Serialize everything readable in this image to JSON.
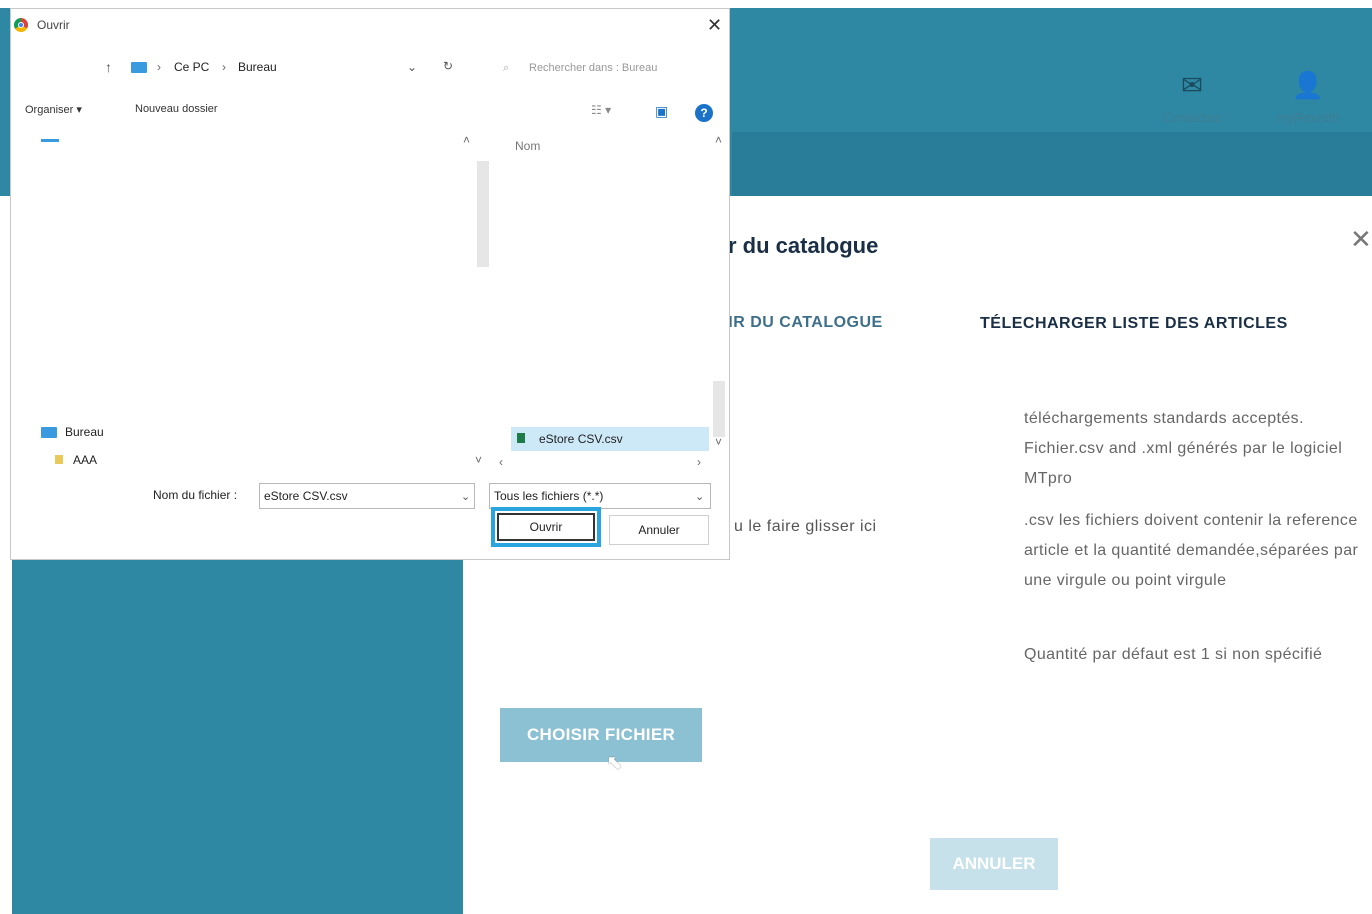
{
  "site": {
    "header": {
      "contact_label": "Contactez",
      "account_label": "myRexroth",
      "contact_icon": "envelope-icon",
      "account_icon": "user-icon"
    }
  },
  "modal": {
    "title_partial": "r du catalogue",
    "tabs": [
      {
        "label": "TIR DU CATALOGUE",
        "active": false
      },
      {
        "label": "TÉLECHARGER LISTE DES ARTICLES",
        "active": true
      }
    ],
    "drag_text": "u le faire glisser ici",
    "info": [
      "téléchargements standards acceptés. Fichier.csv and .xml générés par le logiciel MTpro",
      ".csv les fichiers doivent contenir la reference article et la quantité demandée,séparées par une virgule ou point virgule",
      "Quantité par défaut est 1 si non spécifié"
    ],
    "choose_button": "CHOISIR FICHIER",
    "cancel_button": "ANNULER",
    "close_glyph": "✕"
  },
  "dialog": {
    "title": "Ouvrir",
    "breadcrumb": [
      "Ce PC",
      "Bureau"
    ],
    "search_placeholder": "Rechercher dans : Bureau",
    "toolbar": {
      "organize": "Organiser ▾",
      "new_folder": "Nouveau dossier"
    },
    "column_header": "Nom",
    "nav_tree": [
      {
        "label": "Bureau",
        "icon": "desktop-folder-icon"
      },
      {
        "label": "AAA",
        "icon": "folder-icon"
      }
    ],
    "files": [
      {
        "name": "eStore CSV.csv",
        "selected": true
      }
    ],
    "filename_label": "Nom du fichier :",
    "filename_value": "eStore CSV.csv",
    "filetype_value": "Tous les fichiers (*.*)",
    "open_button": "Ouvrir",
    "cancel_button": "Annuler"
  },
  "colors": {
    "brand_blue": "#2e87a3",
    "highlight": "#2aa5e0"
  }
}
